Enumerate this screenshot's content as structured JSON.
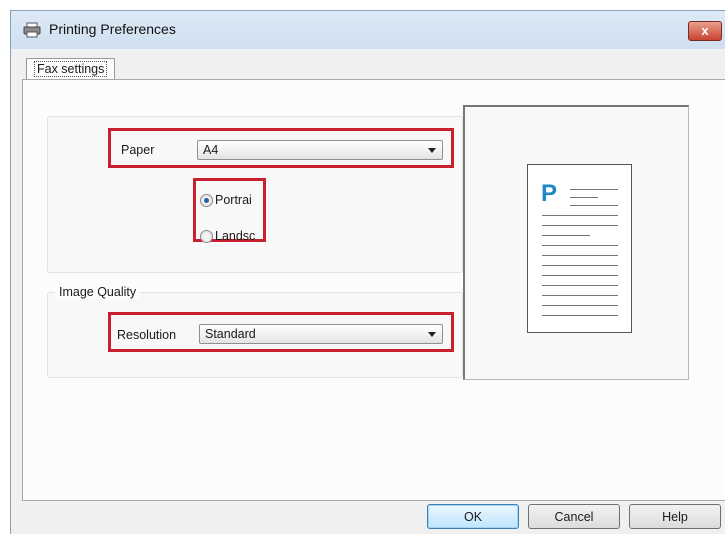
{
  "window": {
    "title": "Printing Preferences",
    "close_label": "x"
  },
  "tabs": [
    {
      "label": "Fax settings",
      "active": true
    }
  ],
  "paper": {
    "label": "Paper",
    "value": "A4"
  },
  "orientation": {
    "options": [
      {
        "label": "Portrai",
        "selected": true
      },
      {
        "label": "Landsc",
        "selected": false
      }
    ]
  },
  "image_quality": {
    "group_label": "Image Quality",
    "resolution_label": "Resolution",
    "resolution_value": "Standard"
  },
  "preview": {
    "letter": "P"
  },
  "buttons": {
    "ok": "OK",
    "cancel": "Cancel",
    "help": "Help"
  },
  "colors": {
    "highlight": "#c8202f",
    "accent": "#1e88c8"
  }
}
